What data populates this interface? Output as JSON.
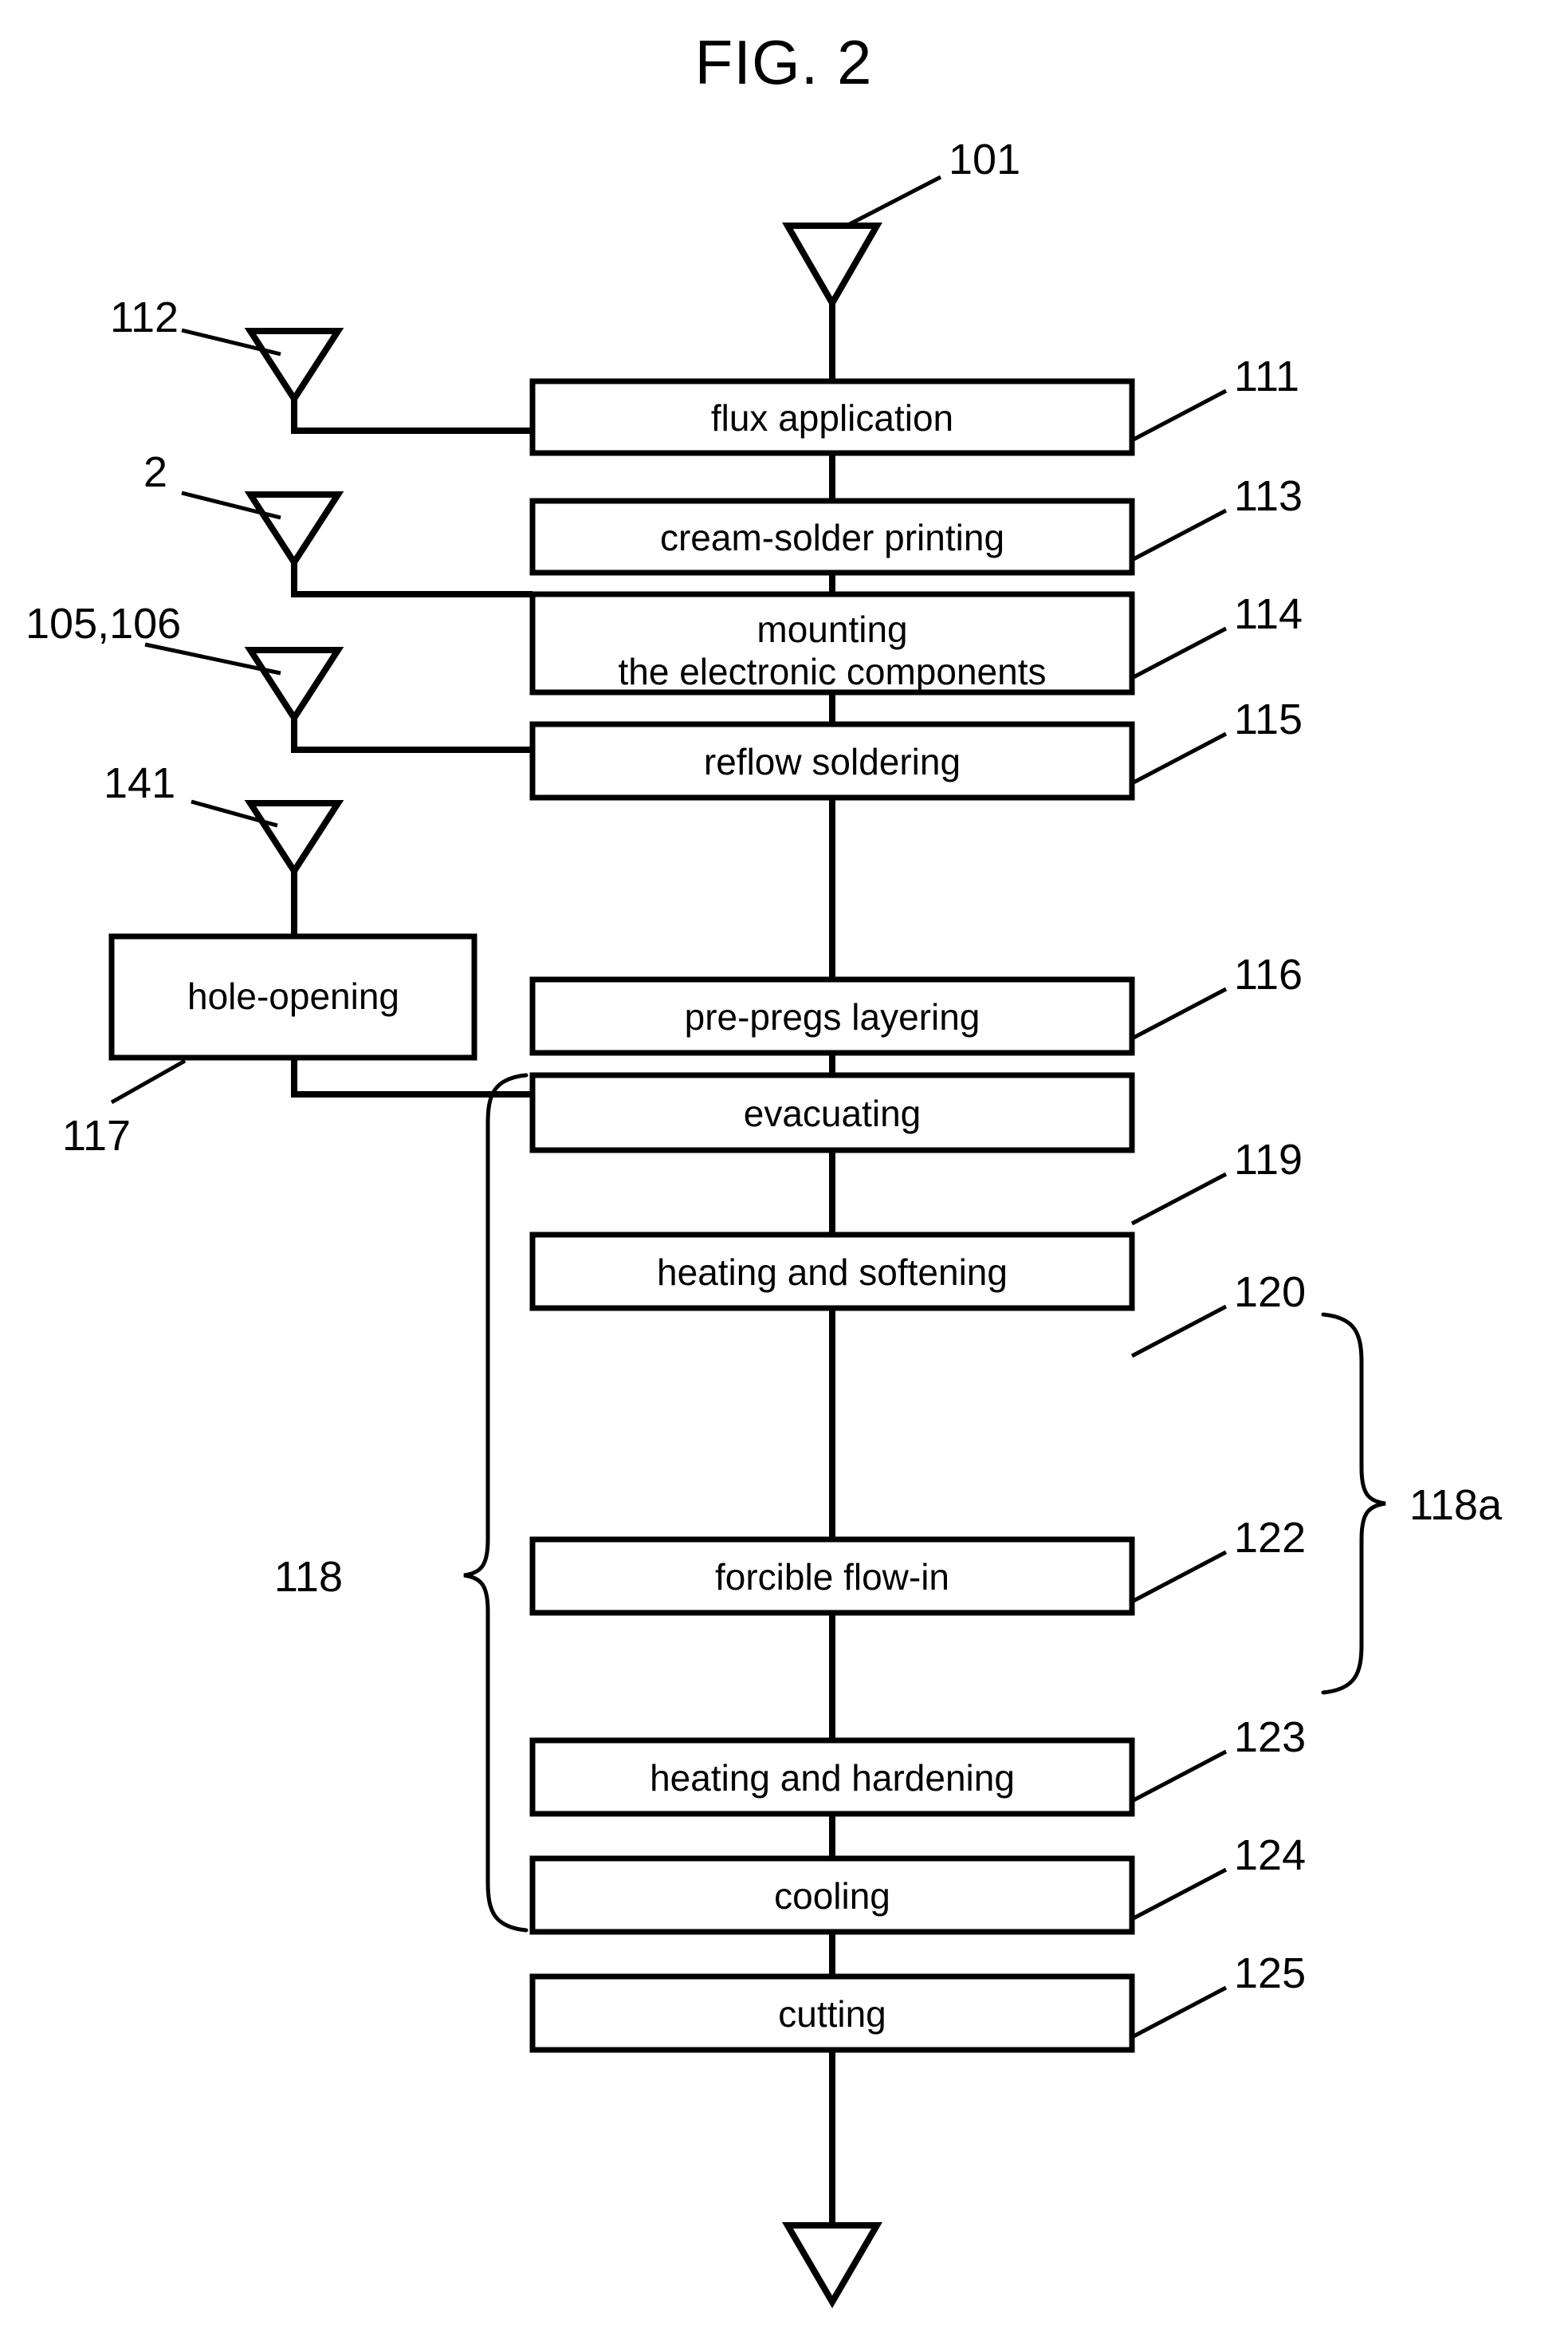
{
  "figure": {
    "title": "FIG. 2",
    "type": "process-flowchart"
  },
  "boxes": [
    {
      "id": "b111",
      "label": "flux application",
      "ref": "111"
    },
    {
      "id": "b113",
      "label": "cream-solder printing",
      "ref": "113"
    },
    {
      "id": "b114",
      "label_line1": "mounting",
      "label_line2": "the electronic components",
      "ref": "114"
    },
    {
      "id": "b115",
      "label": "reflow soldering",
      "ref": "115"
    },
    {
      "id": "b116",
      "label": "pre-pregs layering",
      "ref": "116"
    },
    {
      "id": "b119",
      "label": "evacuating",
      "ref": "119"
    },
    {
      "id": "b120",
      "label": "heating and softening",
      "ref": "120"
    },
    {
      "id": "b122",
      "label": "forcible flow-in",
      "ref": "122"
    },
    {
      "id": "b123",
      "label": "heating and hardening",
      "ref": "123"
    },
    {
      "id": "b124",
      "label": "cooling",
      "ref": "124"
    },
    {
      "id": "b125",
      "label": "cutting",
      "ref": "125"
    }
  ],
  "side_box": {
    "id": "b117",
    "label": "hole-opening",
    "ref": "117"
  },
  "input_triangles": [
    {
      "id": "t101",
      "ref": "101",
      "target": "flux application"
    },
    {
      "id": "t112",
      "ref": "112",
      "target": "flux application"
    },
    {
      "id": "t2",
      "ref": "2",
      "target": "cream-solder printing"
    },
    {
      "id": "t105106",
      "ref": "105,106",
      "target": "mounting the electronic components"
    },
    {
      "id": "t141",
      "ref": "141",
      "target": "hole-opening"
    }
  ],
  "output_triangle": {
    "id": "t-out",
    "ref": ""
  },
  "braces": [
    {
      "id": "brace118",
      "ref": "118",
      "side": "left",
      "spans": "evacuating through cooling"
    },
    {
      "id": "brace118a",
      "ref": "118a",
      "side": "right",
      "spans": "heating and softening through forcible flow-in"
    }
  ],
  "colors": {
    "stroke": "#000000",
    "fill": "#ffffff",
    "background": "#ffffff"
  }
}
